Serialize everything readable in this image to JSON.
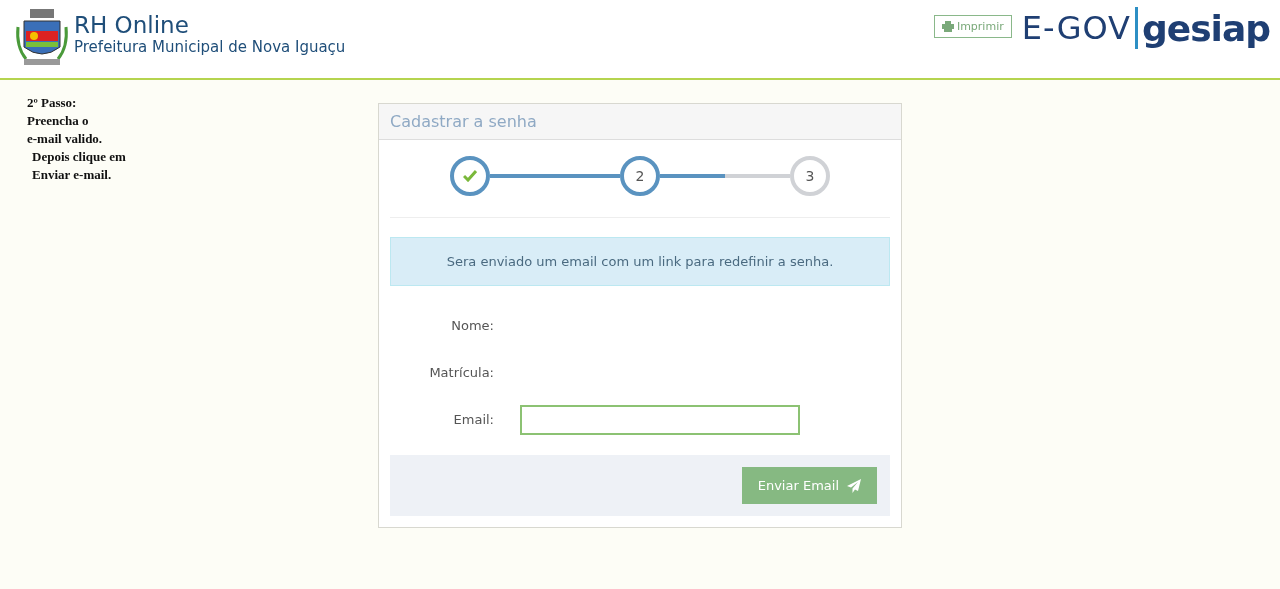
{
  "header": {
    "title": "RH Online",
    "subtitle": "Prefeitura Municipal de Nova Iguaçu",
    "print_button": "Imprimir",
    "logo_left": "E-GOV",
    "logo_right": "gesiap"
  },
  "instructions": [
    "2º Passo:",
    "Preencha o",
    "e-mail valido.",
    "Depois clique em",
    "Enviar e-mail."
  ],
  "panel": {
    "title": "Cadastrar a senha",
    "steps": [
      {
        "completed": true,
        "current": false
      },
      {
        "label": "2",
        "completed": false,
        "current": true
      },
      {
        "label": "3",
        "completed": false,
        "current": false
      }
    ],
    "alert": "Sera enviado um email com um link para redefinir a senha.",
    "fields": [
      {
        "label": "Nome:",
        "kind": "text"
      },
      {
        "label": "Matrícula:",
        "kind": "text"
      },
      {
        "label": "Email:",
        "kind": "input"
      }
    ],
    "submit": "Enviar Email"
  }
}
